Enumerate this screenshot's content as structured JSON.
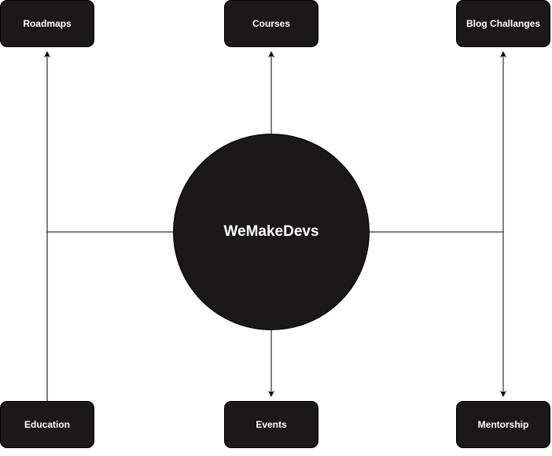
{
  "hub": {
    "label": "WeMakeDevs"
  },
  "nodes": {
    "roadmaps": "Roadmaps",
    "courses": "Courses",
    "blog_challenges": "Blog Challanges",
    "education": "Education",
    "events": "Events",
    "mentorship": "Mentorship"
  },
  "colors": {
    "node_fill": "#1a1818",
    "node_text": "#ffffff",
    "connector": "#000000",
    "background": "#ffffff"
  }
}
